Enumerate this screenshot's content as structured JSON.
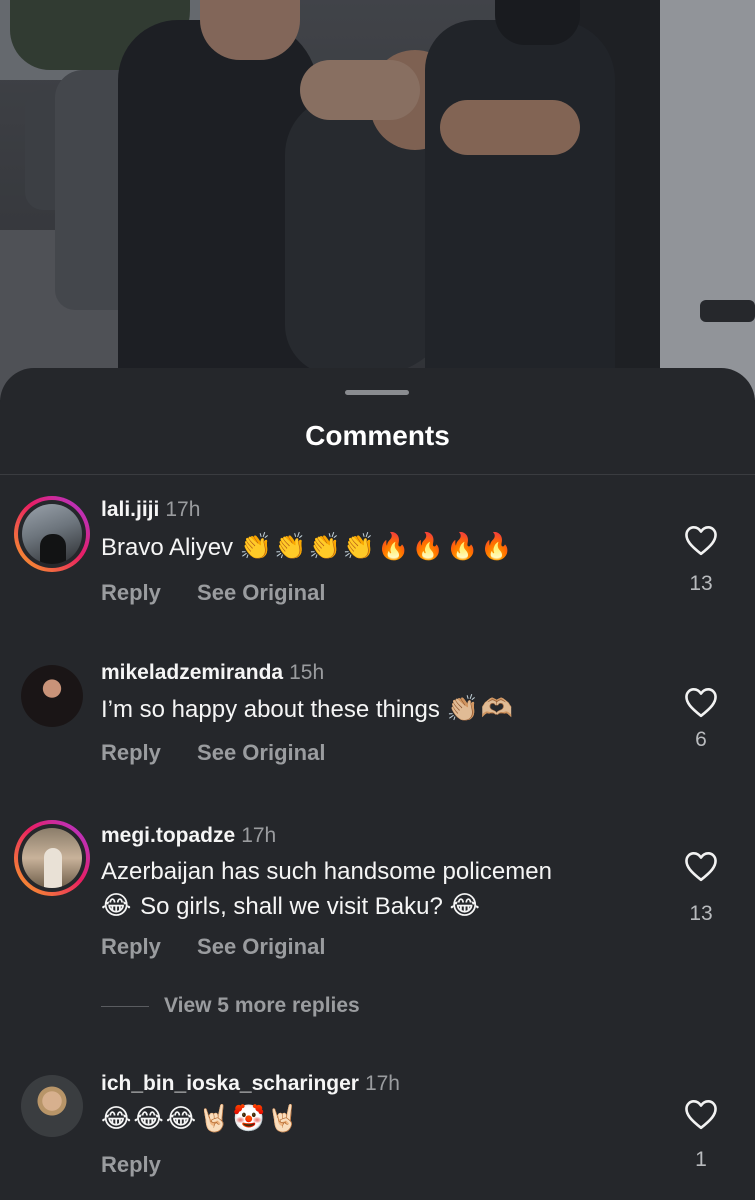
{
  "sheet": {
    "title": "Comments"
  },
  "comments": [
    {
      "username": "lali.jiji",
      "time": "17h",
      "text": "Bravo Aliyev",
      "emoji": "👏👏👏👏🔥🔥🔥🔥",
      "reply_label": "Reply",
      "see_original_label": "See Original",
      "likes": "13"
    },
    {
      "username": "mikeladzemiranda",
      "time": "15h",
      "text": "I’m so happy about these things",
      "emoji": "👏🏼🫶🏼",
      "reply_label": "Reply",
      "see_original_label": "See Original",
      "likes": "6"
    },
    {
      "username": "megi.topadze",
      "time": "17h",
      "text_line1": "Azerbaijan has such handsome policemen",
      "emoji_line2_start": "😂",
      "text_line2": "So girls, shall we visit Baku?",
      "emoji_line2_end": "😂",
      "reply_label": "Reply",
      "see_original_label": "See Original",
      "likes": "13",
      "view_more_replies": "View 5 more replies"
    },
    {
      "username": "ich_bin_ioska_scharinger",
      "time": "17h",
      "emoji": "😂😂😂🤘🏻🤡🤘🏻",
      "reply_label": "Reply",
      "likes": "1"
    }
  ],
  "icons": {
    "like": "heart-outline-icon"
  },
  "colors": {
    "background": "#25272b",
    "secondary_text": "#9a9c9f",
    "story_ring_start": "#f9a825",
    "story_ring_end": "#a93ae0"
  }
}
